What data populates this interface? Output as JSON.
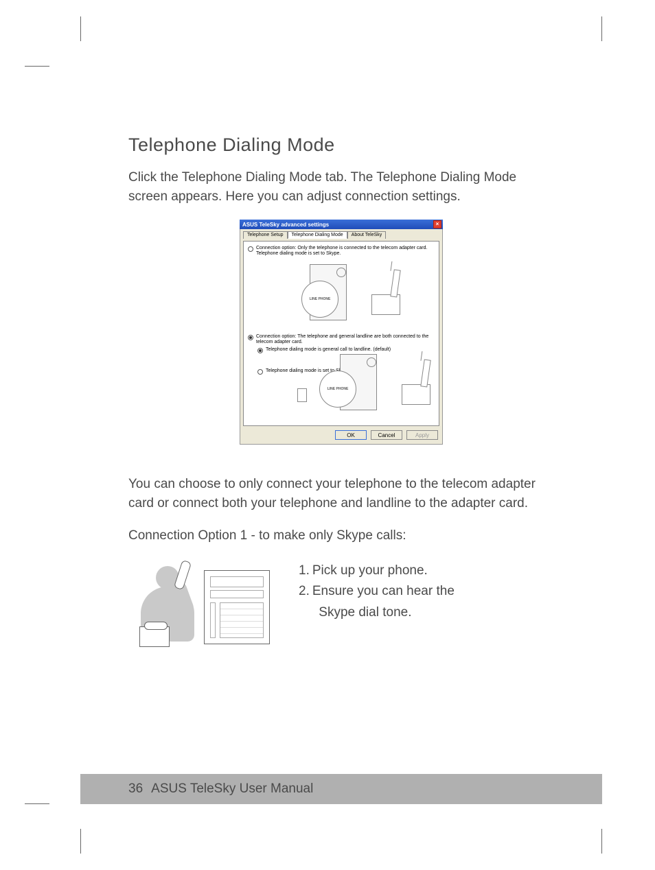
{
  "heading": "Telephone Dialing Mode",
  "intro": "Click the Telephone Dialing Mode tab. The Telephone Dialing Mode screen appears. Here you can adjust connection settings.",
  "dialog": {
    "title": "ASUS TeleSky advanced settings",
    "tabs": {
      "setup": "Telephone Setup",
      "dialing": "Telephone Dialing Mode",
      "about": "About TeleSky"
    },
    "opt1": "Connection option: Only the telephone is connected to the telecom adapter card. Telephone dialing mode is set to Skype.",
    "opt2": "Connection option: The telephone and general landline are both connected to the telecom adapter card.",
    "sub1": "Telephone dialing mode is general call to landline. (default)",
    "sub2": "Telephone dialing mode is set to Skype.",
    "magLabel": "LINE PHONE",
    "buttons": {
      "ok": "OK",
      "cancel": "Cancel",
      "apply": "Apply"
    }
  },
  "para2": "You can choose to only connect your telephone to the telecom adapter card or connect both your telephone and landline to the adapter card.",
  "para3": "Connection Option 1 - to make only Skype calls:",
  "steps": {
    "s1num": "1.",
    "s1": "Pick up your phone.",
    "s2num": "2.",
    "s2a": "Ensure you can hear the",
    "s2b": "Skype dial tone."
  },
  "footer": {
    "page": "36",
    "title": "ASUS TeleSky User Manual"
  }
}
